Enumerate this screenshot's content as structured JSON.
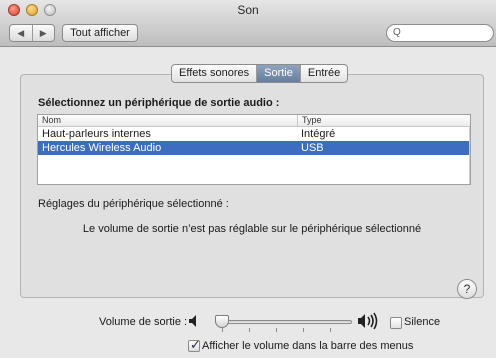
{
  "window": {
    "title": "Son"
  },
  "toolbar": {
    "back_glyph": "◀",
    "forward_glyph": "▶",
    "show_all_label": "Tout afficher",
    "search_placeholder": "",
    "search_glyph": "Q"
  },
  "tabs": [
    {
      "label": "Effets sonores",
      "active": false
    },
    {
      "label": "Sortie",
      "active": true
    },
    {
      "label": "Entrée",
      "active": false
    }
  ],
  "output": {
    "section_title": "Sélectionnez un périphérique de sortie audio :",
    "columns": {
      "name": "Nom",
      "type": "Type"
    },
    "devices": [
      {
        "name": "Haut-parleurs internes",
        "type": "Intégré",
        "selected": false
      },
      {
        "name": "Hercules Wireless Audio",
        "type": "USB",
        "selected": true
      }
    ],
    "settings_label": "Réglages du périphérique sélectionné :",
    "settings_note": "Le volume de sortie n’est pas réglable sur le périphérique sélectionné"
  },
  "help": {
    "label": "?"
  },
  "volume": {
    "label": "Volume de sortie :",
    "level": 0.0,
    "mute_label": "Silence",
    "mute_checked": false,
    "show_in_menubar_label": "Afficher le volume dans la barre des menus",
    "show_in_menubar_checked": true
  },
  "colors": {
    "selection": "#3b6ebf",
    "active_tab": "#7890ad"
  }
}
